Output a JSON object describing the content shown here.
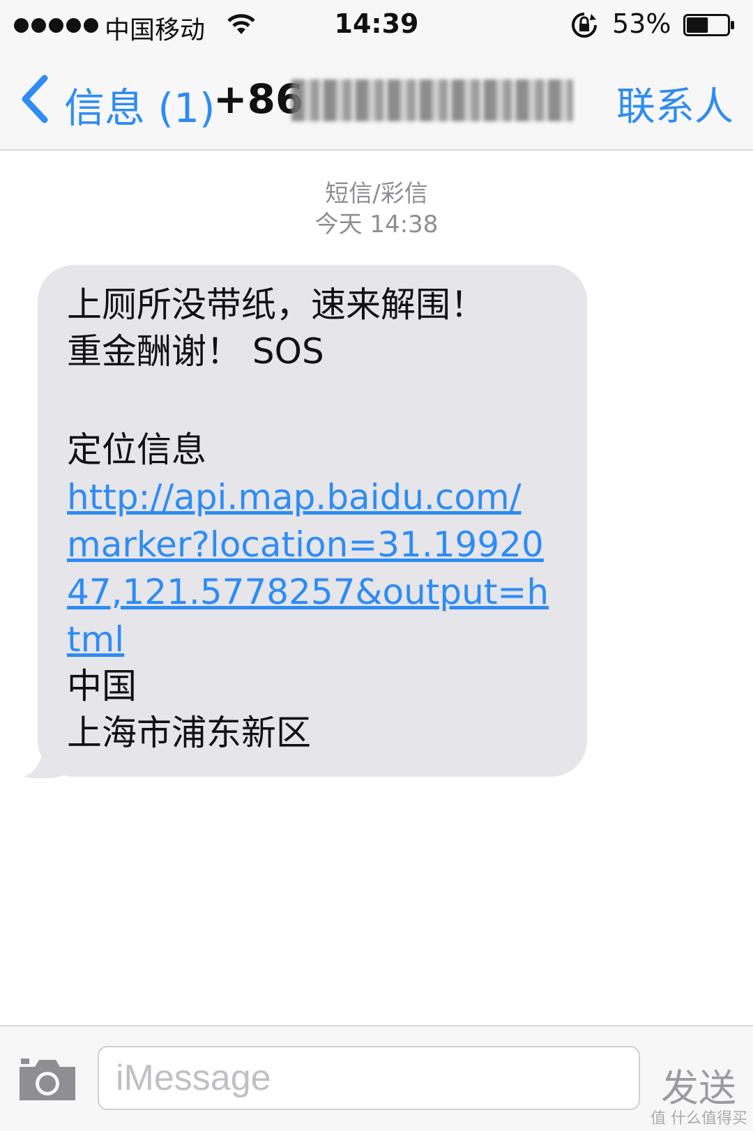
{
  "status_bar": {
    "carrier": "中国移动",
    "time": "14:39",
    "battery_percent": "53%",
    "battery_level": 0.53,
    "signal_dots": 5
  },
  "nav": {
    "back_label": "信息 (1)",
    "title_prefix": "+86",
    "contact_label": "联系人"
  },
  "thread": {
    "service": "短信/彩信",
    "timestamp": "今天 14:38"
  },
  "message": {
    "line1": "上厕所没带纸，速来解围！",
    "line2": "重金酬谢！ SOS",
    "location_heading": "定位信息",
    "link": "http://api.map.baidu.com/marker?location=31.1992047,121.5778257&output=html",
    "country": "中国",
    "region": "上海市浦东新区"
  },
  "composer": {
    "placeholder": "iMessage",
    "send_label": "发送"
  },
  "watermark": "值 什么值得买"
}
